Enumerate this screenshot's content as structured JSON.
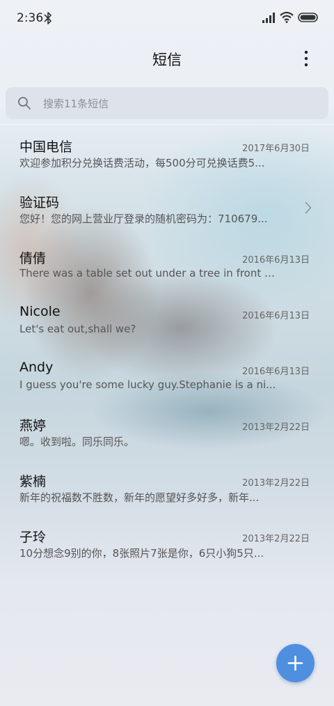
{
  "status_bar": {
    "time": "2:36",
    "icons": [
      "bluetooth-icon",
      "signal-icon",
      "wifi-icon",
      "battery-icon"
    ]
  },
  "header": {
    "title": "短信",
    "menu_icon": "more-vert-icon"
  },
  "search": {
    "icon": "search-icon",
    "placeholder": "搜索11条短信"
  },
  "messages": [
    {
      "name": "中国电信",
      "date": "2017年6月30日",
      "preview": "欢迎参加积分兑换话费活动，每500分可兑换话费5..."
    },
    {
      "name": "验证码",
      "date": "",
      "preview": "您好！您的网上营业厅登录的随机密码为：710679..."
    },
    {
      "name": "倩倩",
      "date": "2016年6月13日",
      "preview": "There was a table set out under a tree in front of ..."
    },
    {
      "name": "Nicole",
      "date": "2016年6月13日",
      "preview": "Let's eat out,shall we?"
    },
    {
      "name": "Andy",
      "date": "2016年6月13日",
      "preview": "I guess you're some lucky guy.Stephanie is a ni..."
    },
    {
      "name": "燕婷",
      "date": "2013年2月22日",
      "preview": "嗯。收到啦。同乐同乐。"
    },
    {
      "name": "紫楠",
      "date": "2013年2月22日",
      "preview": "新年的祝福数不胜数，新年的愿望好多好多，新年..."
    },
    {
      "name": "子玲",
      "date": "2013年2月22日",
      "preview": "10分想念9别的你，8张照片7张是你，6只小狗5只..."
    }
  ],
  "fab": {
    "icon": "plus-icon"
  },
  "colors": {
    "fab": "#4f8fe0",
    "text_primary": "#111111",
    "text_secondary": "#555555"
  }
}
